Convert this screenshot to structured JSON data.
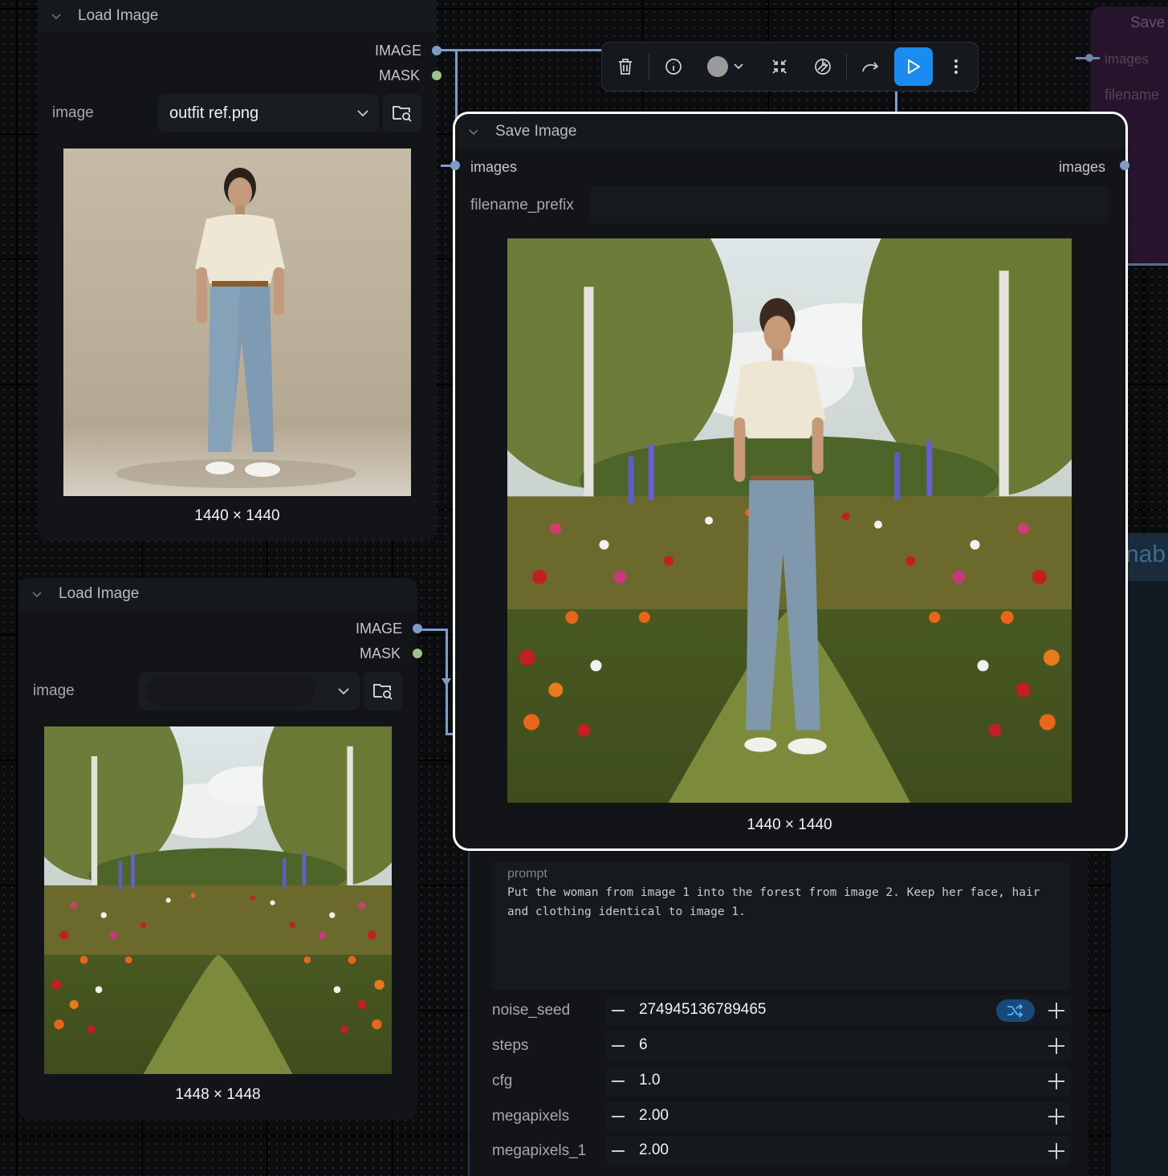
{
  "toolbar": {
    "buttons": [
      "delete-icon",
      "info-icon",
      "color-circle-icon",
      "chevron-down-icon",
      "collapse-icon",
      "bypass-icon",
      "redo-icon",
      "run-icon",
      "more-vertical-icon"
    ],
    "accent": "#1a8cf0"
  },
  "load_image_1": {
    "title": "Load Image",
    "out_image": "IMAGE",
    "out_mask": "MASK",
    "widget_label": "image",
    "selected_file": "outfit ref.png",
    "dims": "1440 × 1440"
  },
  "load_image_2": {
    "title": "Load Image",
    "out_image": "IMAGE",
    "out_mask": "MASK",
    "widget_label": "image",
    "selected_file": "",
    "dims": "1448 × 1448"
  },
  "save_image": {
    "title": "Save Image",
    "in_images": "images",
    "out_images": "images",
    "filename_label": "filename_prefix",
    "filename_value": "",
    "dims": "1440 × 1440"
  },
  "bg_save_node": {
    "title": "Save",
    "slot": "images",
    "widget": "filename",
    "partial_text": "nab"
  },
  "prompt_node": {
    "prompt_label": "prompt",
    "prompt_text": "Put the woman from image 1 into the forest from image 2. Keep her face, hair and clothing identical to image 1.",
    "widgets": [
      {
        "label": "noise_seed",
        "value": "274945136789465"
      },
      {
        "label": "steps",
        "value": "6"
      },
      {
        "label": "cfg",
        "value": "1.0"
      },
      {
        "label": "megapixels",
        "value": "2.00"
      },
      {
        "label": "megapixels_1",
        "value": "2.00"
      }
    ]
  },
  "colors": {
    "image_socket": "#7d9cc7",
    "mask_socket": "#9cc28a",
    "selected_border": "#ffffff",
    "bg_node_purple": "#2a1530"
  }
}
